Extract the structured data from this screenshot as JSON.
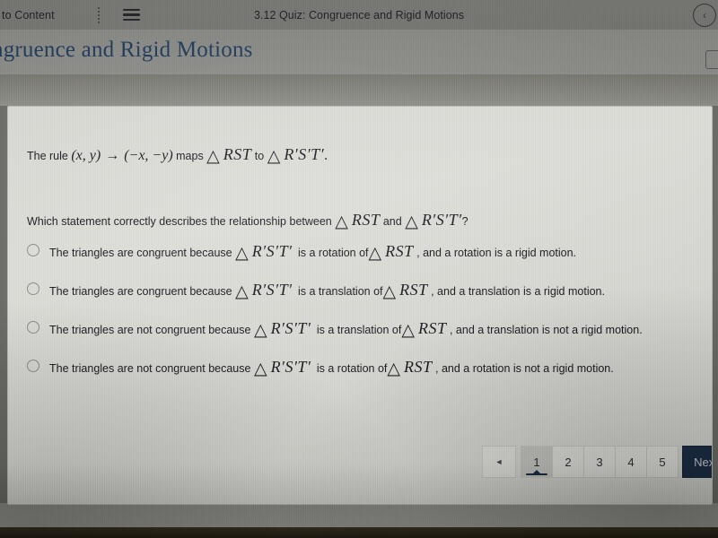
{
  "topbar": {
    "skip_link": "to Content",
    "menu_icon": "hamburger-icon",
    "doc_title": "3.12 Quiz: Congruence and Rigid Motions",
    "collapse_icon": "‹"
  },
  "page": {
    "title": "ngruence and Rigid Motions"
  },
  "quiz": {
    "rule": {
      "prefix": "The rule ",
      "domain_pair": "(x, y)",
      "arrow": "→",
      "range_pair": "(−x, −y)",
      "maps": " maps ",
      "triangle": "△",
      "tri1_label": "RST",
      "to": " to ",
      "tri2_label": "R′S′T′",
      "period": "."
    },
    "question": {
      "prefix": "Which statement correctly describes the relationship between ",
      "triangle": "△",
      "tri1_label": "RST",
      "and": " and ",
      "tri2_label": "R′S′T′",
      "suffix": "?"
    },
    "options": [
      {
        "id": "option-a",
        "selected": false,
        "lead": "The triangles are congruent because ",
        "triangle": "△",
        "tri_label": "R′S′T′",
        "middle": " is a rotation of",
        "triangle2": "△",
        "tri_label2": "RST",
        "tail": " , and a rotation is a rigid motion."
      },
      {
        "id": "option-b",
        "selected": false,
        "lead": "The triangles are congruent because ",
        "triangle": "△",
        "tri_label": "R′S′T′",
        "middle": " is a translation of",
        "triangle2": "△",
        "tri_label2": "RST",
        "tail": " , and a translation is a rigid motion."
      },
      {
        "id": "option-c",
        "selected": false,
        "lead": "The triangles are not congruent because ",
        "triangle": "△",
        "tri_label": "R′S′T′",
        "middle": " is a translation of",
        "triangle2": "△",
        "tri_label2": "RST",
        "tail": " , and a translation is not a rigid motion."
      },
      {
        "id": "option-d",
        "selected": false,
        "lead": "The triangles are not congruent because ",
        "triangle": "△",
        "tri_label": "R′S′T′",
        "middle": " is a rotation of",
        "triangle2": "△",
        "tri_label2": "RST",
        "tail": " , and a rotation is not a rigid motion."
      }
    ]
  },
  "pagination": {
    "prev_label": "◄",
    "pages": [
      "1",
      "2",
      "3",
      "4",
      "5"
    ],
    "active_page": "1",
    "next_label": "Next",
    "next_color": "#1b2c44"
  }
}
